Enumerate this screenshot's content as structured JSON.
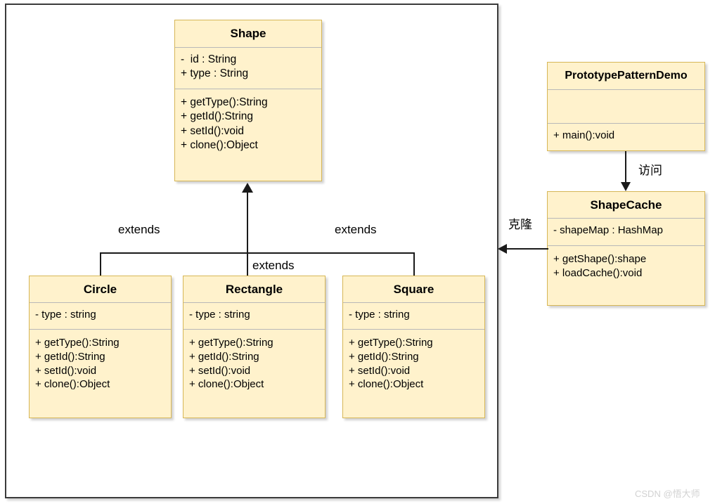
{
  "diagram": {
    "title": "Prototype Pattern UML Class Diagram",
    "colors": {
      "box_fill": "#fff2cc",
      "box_border": "#d6b656",
      "line": "#1a1a1a",
      "frame": "#3b3b3b",
      "separator": "#b8b8b8"
    }
  },
  "classes": {
    "shape": {
      "name": "Shape",
      "attributes": [
        "-  id : String",
        "+ type : String"
      ],
      "methods": [
        "+ getType():String",
        "+ getId():String",
        "+ setId():void",
        "+ clone():Object"
      ]
    },
    "circle": {
      "name": "Circle",
      "attributes": [
        "- type : string"
      ],
      "methods": [
        "+ getType():String",
        "+ getId():String",
        "+ setId():void",
        "+ clone():Object"
      ]
    },
    "rectangle": {
      "name": "Rectangle",
      "attributes": [
        "- type : string"
      ],
      "methods": [
        "+ getType():String",
        "+ getId():String",
        "+ setId():void",
        "+ clone():Object"
      ]
    },
    "square": {
      "name": "Square",
      "attributes": [
        "- type : string"
      ],
      "methods": [
        "+ getType():String",
        "+ getId():String",
        "+ setId():void",
        "+ clone():Object"
      ]
    },
    "demo": {
      "name": "PrototypePatternDemo",
      "attributes": [],
      "methods": [
        "+ main():void"
      ]
    },
    "shapecache": {
      "name": "ShapeCache",
      "attributes": [
        "- shapeMap : HashMap"
      ],
      "methods": [
        "+ getShape():shape",
        "+ loadCache():void"
      ]
    }
  },
  "edges": {
    "extends_left": "extends",
    "extends_middle": "extends",
    "extends_right": "extends",
    "demo_to_cache": "访问",
    "cache_to_shape": "克隆"
  },
  "watermark": {
    "text": "CSDN @悟大师"
  }
}
